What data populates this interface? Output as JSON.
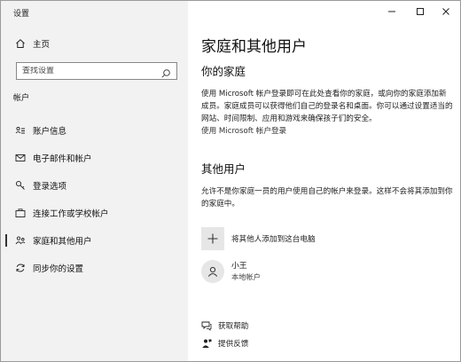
{
  "window": {
    "title": "设置",
    "buttons": {
      "minimize": "minimize",
      "maximize": "maximize",
      "close": "close"
    }
  },
  "sidebar": {
    "home_label": "主页",
    "search_placeholder": "查找设置",
    "section_label": "帐户",
    "items": [
      {
        "label": "账户信息",
        "icon": "account-info-icon"
      },
      {
        "label": "电子邮件和帐户",
        "icon": "mail-icon"
      },
      {
        "label": "登录选项",
        "icon": "key-icon"
      },
      {
        "label": "连接工作或学校帐户",
        "icon": "briefcase-icon"
      },
      {
        "label": "家庭和其他用户",
        "icon": "family-icon",
        "active": true
      },
      {
        "label": "同步你的设置",
        "icon": "sync-icon"
      }
    ]
  },
  "main": {
    "title": "家庭和其他用户",
    "family": {
      "heading": "你的家庭",
      "description": "使用 Microsoft 帐户登录即可在此处查看你的家庭，或向你的家庭添加新成员。家庭成员可以获得他们自己的登录名和桌面。你可以通过设置适当的网站、时间限制、应用和游戏来确保孩子们的安全。",
      "link": "使用 Microsoft 帐户登录"
    },
    "other_users": {
      "heading": "其他用户",
      "description": "允许不是你家庭一员的用户使用自己的帐户来登录。这样不会将其添加到你的家庭中。",
      "add_label": "将其他人添加到这台电脑",
      "user": {
        "name": "小王",
        "type": "本地帐户"
      }
    },
    "help": {
      "get_help": "获取帮助",
      "feedback": "提供反馈"
    }
  }
}
